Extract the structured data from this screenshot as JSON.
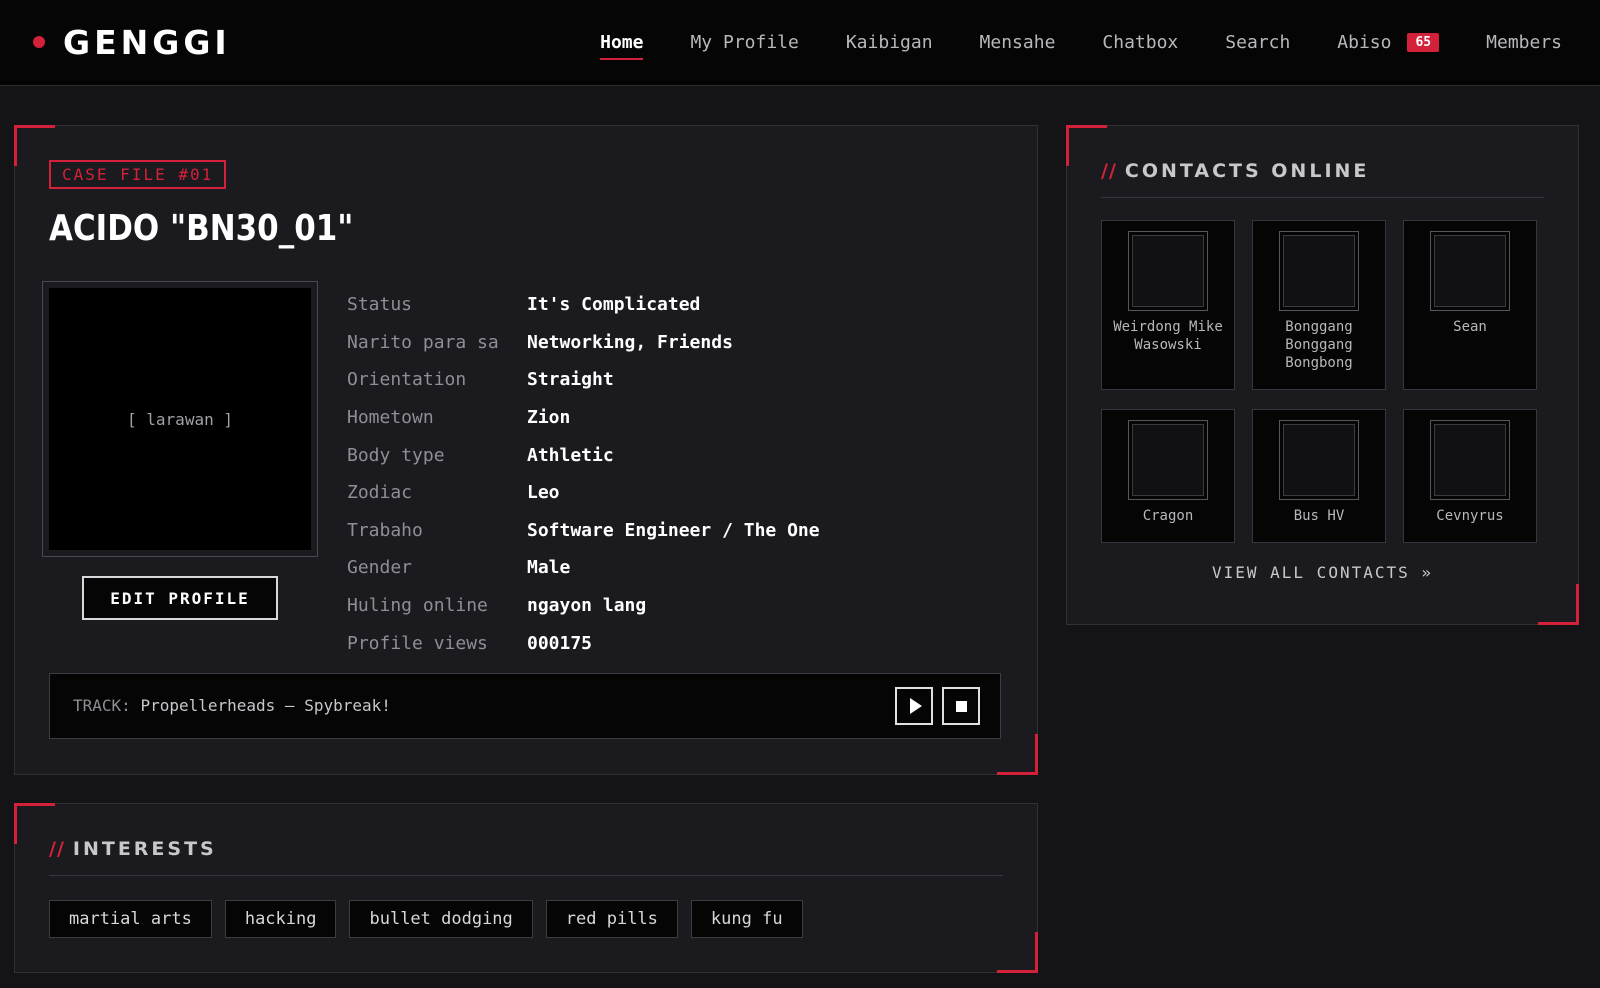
{
  "brand": {
    "name": "GENGGI"
  },
  "nav": {
    "items": [
      {
        "label": "Home",
        "active": true
      },
      {
        "label": "My Profile"
      },
      {
        "label": "Kaibigan"
      },
      {
        "label": "Mensahe"
      },
      {
        "label": "Chatbox"
      },
      {
        "label": "Search"
      },
      {
        "label": "Abiso",
        "badge": "65"
      },
      {
        "label": "Members"
      }
    ]
  },
  "profile": {
    "case_tag": "CASE FILE #01",
    "name": "ACIDO \"BN30_01\"",
    "photo_placeholder": "[ larawan ]",
    "edit_button": "EDIT PROFILE",
    "details": [
      {
        "label": "Status",
        "value": "It's Complicated"
      },
      {
        "label": "Narito para sa",
        "value": "Networking, Friends"
      },
      {
        "label": "Orientation",
        "value": "Straight"
      },
      {
        "label": "Hometown",
        "value": "Zion"
      },
      {
        "label": "Body type",
        "value": "Athletic"
      },
      {
        "label": "Zodiac",
        "value": "Leo"
      },
      {
        "label": "Trabaho",
        "value": "Software Engineer / The One"
      },
      {
        "label": "Gender",
        "value": "Male"
      },
      {
        "label": "Huling online",
        "value": "ngayon lang"
      },
      {
        "label": "Profile views",
        "value": "000175"
      }
    ],
    "player": {
      "prefix": "TRACK:",
      "track": "Propellerheads – Spybreak!",
      "play_icon": "play-icon",
      "stop_icon": "stop-icon"
    }
  },
  "contacts": {
    "slashes": "//",
    "title": "CONTACTS ONLINE",
    "items": [
      {
        "name": "Weirdong Mike Wasowski"
      },
      {
        "name": "Bonggang Bonggang Bongbong"
      },
      {
        "name": "Sean"
      },
      {
        "name": "Cragon"
      },
      {
        "name": "Bus HV"
      },
      {
        "name": "Cevnyrus"
      }
    ],
    "view_all": "VIEW ALL CONTACTS »"
  },
  "interests": {
    "slashes": "//",
    "title": "INTERESTS",
    "tags": [
      "martial arts",
      "hacking",
      "bullet dodging",
      "red pills",
      "kung fu"
    ]
  },
  "colors": {
    "accent": "#d3213a",
    "background": "#141417",
    "panel": "#1b1b1f",
    "black": "#050506"
  }
}
